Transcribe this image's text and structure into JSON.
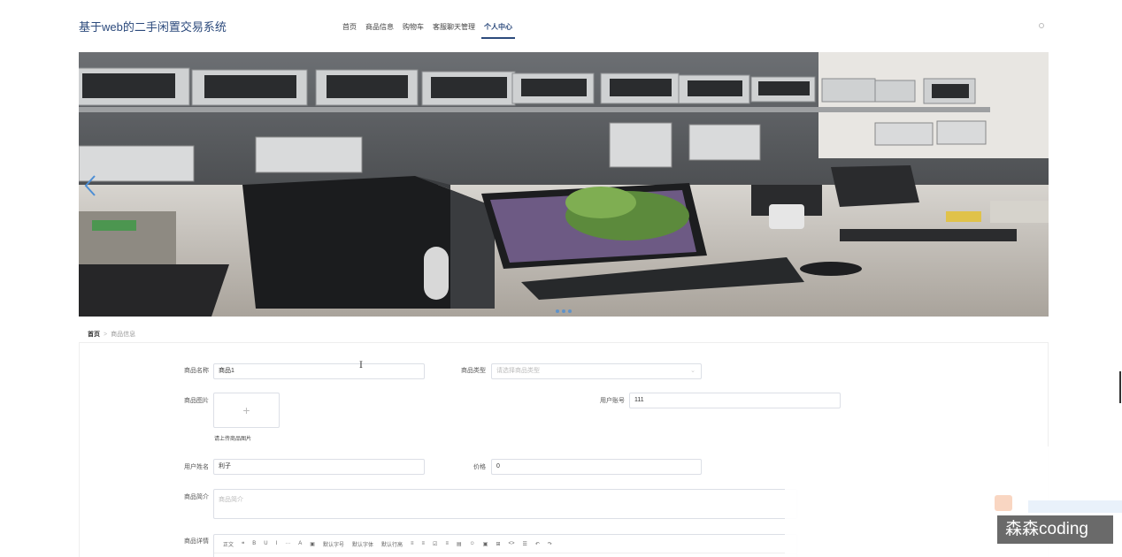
{
  "header": {
    "title": "基于web的二手闲置交易系统",
    "nav": [
      {
        "label": "首页",
        "active": false
      },
      {
        "label": "商品信息",
        "active": false
      },
      {
        "label": "购物车",
        "active": false
      },
      {
        "label": "客服聊天管理",
        "active": false
      },
      {
        "label": "个人中心",
        "active": true
      }
    ]
  },
  "banner": {
    "slides_count": 3,
    "active_slide": 1
  },
  "breadcrumb": {
    "home": "首页",
    "separator": ">",
    "current": "商品信息"
  },
  "form": {
    "product_name": {
      "label": "商品名称",
      "value": "商品1"
    },
    "product_type": {
      "label": "商品类型",
      "placeholder": "请选择商品类型"
    },
    "product_image": {
      "label": "商品图片",
      "hint": "请上传商品图片",
      "upload_symbol": "+"
    },
    "user_account": {
      "label": "用户账号",
      "value": "111"
    },
    "user_name": {
      "label": "用户姓名",
      "value": "利子"
    },
    "price": {
      "label": "价格",
      "value": "0"
    },
    "product_intro": {
      "label": "商品简介",
      "placeholder": "商品简介"
    },
    "product_detail": {
      "label": "商品详情"
    }
  },
  "editor_toolbar": [
    "正文",
    "❝",
    "B",
    "U",
    "I",
    "···",
    "A",
    "▣",
    "默认字号",
    "默认字体",
    "默认行高",
    "≡",
    "≡",
    "☑",
    "≡",
    "▤",
    "☺",
    "▣",
    "⊞",
    "<>",
    "☰",
    "↶",
    "↷"
  ],
  "watermark": "森森coding",
  "colors": {
    "accent": "#2c4a7c",
    "border": "#dcdfe6",
    "carousel_dot": "#4d8ed4"
  }
}
